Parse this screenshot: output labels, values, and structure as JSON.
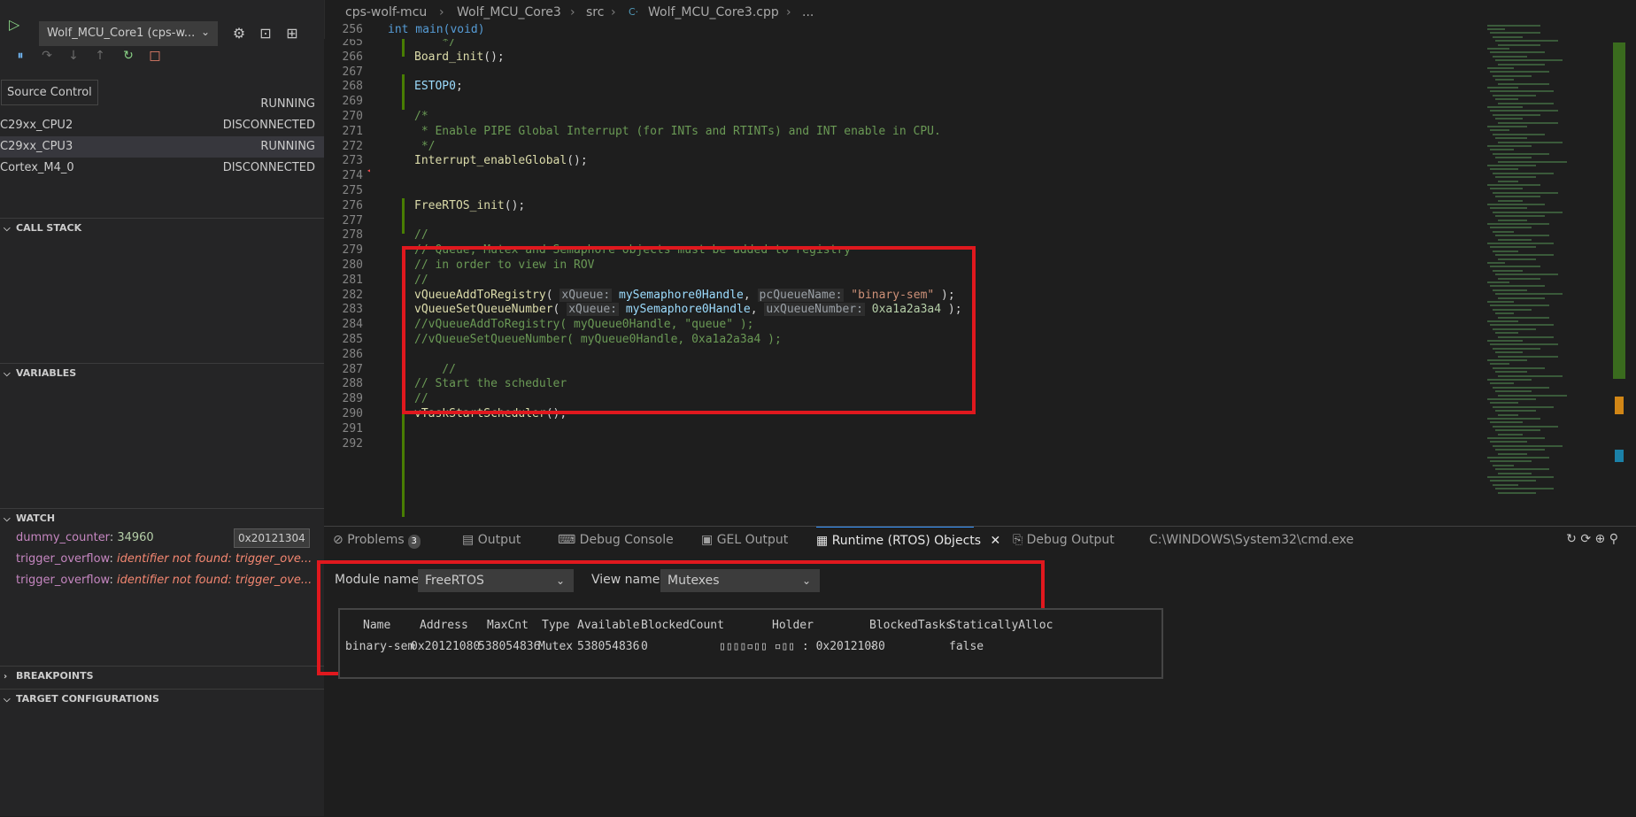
{
  "sidebar": {
    "config_name": "Wolf_MCU_Core1 (cps-w...",
    "tooltip": "Source Control",
    "threads": [
      {
        "name": "",
        "state": "RUNNING"
      },
      {
        "name": "C29xx_CPU2",
        "state": "DISCONNECTED"
      },
      {
        "name": "C29xx_CPU3",
        "state": "RUNNING"
      },
      {
        "name": "Cortex_M4_0",
        "state": "DISCONNECTED"
      }
    ],
    "sections": {
      "call_stack": "CALL STACK",
      "variables": "VARIABLES",
      "watch": "WATCH",
      "breakpoints": "BREAKPOINTS",
      "target_configurations": "TARGET CONFIGURATIONS"
    },
    "watch": [
      {
        "name": "dummy_counter",
        "value": "34960",
        "hex": "0x20121304"
      },
      {
        "name": "trigger_overflow",
        "value": "identifier not found: trigger_ove..."
      },
      {
        "name": "trigger_overflow",
        "value": "identifier not found: trigger_ove..."
      }
    ],
    "colors": {
      "running_accent": "#89d185",
      "stop": "#f48771"
    }
  },
  "breadcrumb": [
    "cps-wolf-mcu",
    "Wolf_MCU_Core3",
    "src",
    "Wolf_MCU_Core3.cpp",
    "..."
  ],
  "editor": {
    "sticky": {
      "num": "256",
      "text": "int main(void)"
    },
    "lines": [
      {
        "num": "265",
        "text": "    */"
      },
      {
        "num": "266",
        "text": "Board_init();"
      },
      {
        "num": "267",
        "text": ""
      },
      {
        "num": "268",
        "text": "ESTOP0;"
      },
      {
        "num": "269",
        "text": ""
      },
      {
        "num": "270",
        "text": "/*"
      },
      {
        "num": "271",
        "text": " * Enable PIPE Global Interrupt (for INTs and RTINTs) and INT enable in CPU."
      },
      {
        "num": "272",
        "text": " */"
      },
      {
        "num": "273",
        "text": "Interrupt_enableGlobal();"
      },
      {
        "num": "274",
        "text": ""
      },
      {
        "num": "275",
        "text": ""
      },
      {
        "num": "276",
        "text": "FreeRTOS_init();"
      },
      {
        "num": "277",
        "text": ""
      },
      {
        "num": "278",
        "text": "//"
      },
      {
        "num": "279",
        "text": "// Queue, Mutex and Semaphore objects must be added to registry"
      },
      {
        "num": "280",
        "text": "// in order to view in ROV"
      },
      {
        "num": "281",
        "text": "//"
      },
      {
        "num": "282",
        "text": "vQueueAddToRegistry( xQueue: mySemaphore0Handle, pcQueueName: \"binary-sem\" );"
      },
      {
        "num": "283",
        "text": "vQueueSetQueueNumber( xQueue: mySemaphore0Handle, uxQueueNumber: 0xa1a2a3a4 );"
      },
      {
        "num": "284",
        "text": "//vQueueAddToRegistry( myQueue0Handle, \"queue\" );"
      },
      {
        "num": "285",
        "text": "//vQueueSetQueueNumber( myQueue0Handle, 0xa1a2a3a4 );"
      },
      {
        "num": "286",
        "text": ""
      },
      {
        "num": "287",
        "text": "    //"
      },
      {
        "num": "288",
        "text": "// Start the scheduler"
      },
      {
        "num": "289",
        "text": "//"
      },
      {
        "num": "290",
        "text": "vTaskStartScheduler();"
      },
      {
        "num": "291",
        "text": ""
      },
      {
        "num": "292",
        "text": ""
      }
    ]
  },
  "panel": {
    "tabs": [
      {
        "label": "Problems",
        "badge": "3"
      },
      {
        "label": "Output"
      },
      {
        "label": "Debug Console"
      },
      {
        "label": "GEL Output"
      },
      {
        "label": "Runtime (RTOS) Objects",
        "active": true
      },
      {
        "label": "Debug Output"
      },
      {
        "label": "C:\\WINDOWS\\System32\\cmd.exe"
      }
    ],
    "module_label": "Module name",
    "module_value": "FreeRTOS",
    "view_label": "View name",
    "view_value": "Mutexes",
    "table": {
      "headers": [
        "Name",
        "Address",
        "MaxCnt",
        "Type",
        "Available",
        "BlockedCount",
        "Holder",
        "BlockedTasks",
        "StaticallyAlloc"
      ],
      "rows": [
        [
          "binary-sem",
          "0x20121080",
          "538054836",
          "Mutex",
          "538054836",
          "0",
          "▯▯▯▯▫▯▯ ▫▯▯ : 0x20121080",
          "-",
          "false"
        ]
      ]
    }
  }
}
